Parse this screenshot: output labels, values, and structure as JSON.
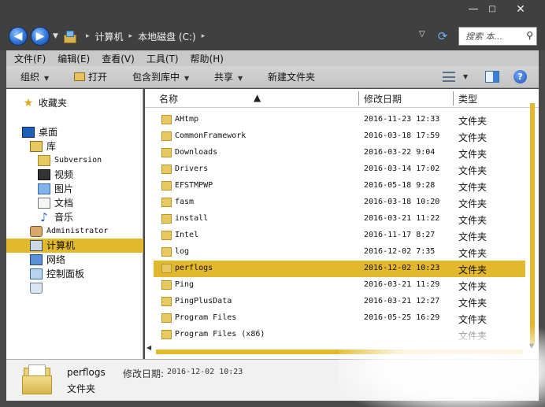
{
  "window": {
    "min": "—",
    "max": "□",
    "close": "✕"
  },
  "address": {
    "back": "◀",
    "forward": "▶",
    "drop": "▼",
    "segments": [
      "计算机",
      "本地磁盘 (C:)"
    ],
    "sep": "▸",
    "tail_caret": "▽",
    "search_placeholder": "搜索 本...",
    "search_icon": "search-icon"
  },
  "menu": [
    "文件(F)",
    "编辑(E)",
    "查看(V)",
    "工具(T)",
    "帮助(H)"
  ],
  "toolbar": {
    "organize": "组织",
    "open": "打开",
    "include": "包含到库中",
    "share": "共享",
    "new_folder": "新建文件夹",
    "caret": "▼",
    "help": "?"
  },
  "nav": {
    "favorites": "收藏夹",
    "desktop": "桌面",
    "libraries": "库",
    "subversion": "Subversion",
    "videos": "视频",
    "pictures": "图片",
    "documents": "文档",
    "music": "音乐",
    "admin": "Administrator",
    "computer": "计算机",
    "network": "网络",
    "control": "控制面板"
  },
  "columns": {
    "name": "名称",
    "date": "修改日期",
    "type": "类型"
  },
  "files": [
    {
      "name": "AHtmp",
      "date": "2016-11-23 12:33",
      "type": "文件夹"
    },
    {
      "name": "CommonFramework",
      "date": "2016-03-18 17:59",
      "type": "文件夹"
    },
    {
      "name": "Downloads",
      "date": "2016-03-22 9:04",
      "type": "文件夹"
    },
    {
      "name": "Drivers",
      "date": "2016-03-14 17:02",
      "type": "文件夹"
    },
    {
      "name": "EFSTMPWP",
      "date": "2016-05-18 9:28",
      "type": "文件夹"
    },
    {
      "name": "fasm",
      "date": "2016-03-18 10:20",
      "type": "文件夹"
    },
    {
      "name": "install",
      "date": "2016-03-21 11:22",
      "type": "文件夹"
    },
    {
      "name": "Intel",
      "date": "2016-11-17 8:27",
      "type": "文件夹"
    },
    {
      "name": "log",
      "date": "2016-12-02 7:35",
      "type": "文件夹"
    },
    {
      "name": "perflogs",
      "date": "2016-12-02 10:23",
      "type": "文件夹"
    },
    {
      "name": "Ping",
      "date": "2016-03-21 11:29",
      "type": "文件夹"
    },
    {
      "name": "PingPlusData",
      "date": "2016-03-21 12:27",
      "type": "文件夹"
    },
    {
      "name": "Program Files",
      "date": "2016-05-25 16:29",
      "type": "文件夹"
    },
    {
      "name": "Program Files (x86)",
      "date": "",
      "type": "文件夹"
    }
  ],
  "selected_index": 9,
  "details": {
    "name": "perflogs",
    "date_label": "修改日期:",
    "date": "2016-12-02 10:23",
    "type": "文件夹"
  },
  "colors": {
    "selection": "#e2b92c",
    "chrome": "#404040",
    "bar": "#c9c9c9"
  }
}
